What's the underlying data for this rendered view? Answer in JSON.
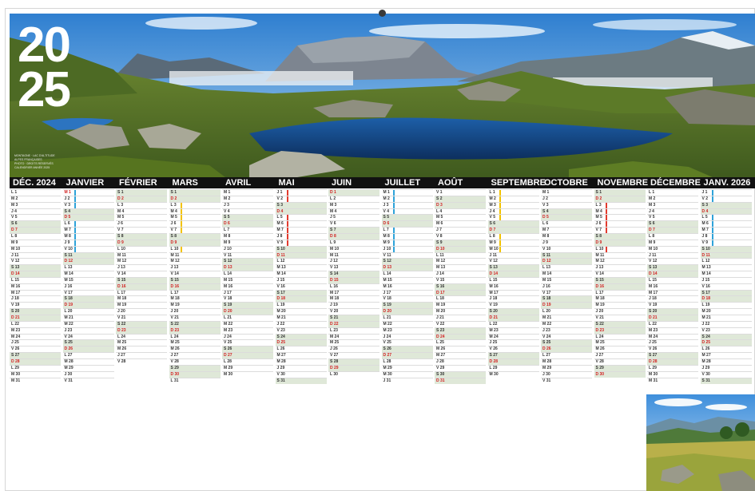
{
  "year_lines": [
    "20",
    "25"
  ],
  "credit_lines": [
    "MONTAGNE · LAC D'ALTITUDE",
    "ALPES FRANÇAISES",
    "PHOTO · DROITS RÉSERVÉS",
    "CALENDRIER ANNÉE 2025"
  ],
  "months": [
    {
      "label": "DÉC. 2024",
      "days": 31,
      "start": 0
    },
    {
      "label": "JANVIER",
      "days": 31,
      "start": 2
    },
    {
      "label": "FÉVRIER",
      "days": 28,
      "start": 5
    },
    {
      "label": "MARS",
      "days": 31,
      "start": 5
    },
    {
      "label": "AVRIL",
      "days": 30,
      "start": 1
    },
    {
      "label": "MAI",
      "days": 31,
      "start": 3
    },
    {
      "label": "JUIN",
      "days": 30,
      "start": 6
    },
    {
      "label": "JUILLET",
      "days": 31,
      "start": 1
    },
    {
      "label": "AOÛT",
      "days": 31,
      "start": 4
    },
    {
      "label": "SEPTEMBRE",
      "days": 30,
      "start": 0
    },
    {
      "label": "OCTOBRE",
      "days": 31,
      "start": 2
    },
    {
      "label": "NOVEMBRE",
      "days": 30,
      "start": 5
    },
    {
      "label": "DÉCEMBRE",
      "days": 31,
      "start": 0
    },
    {
      "label": "JANV. 2026",
      "days": 31,
      "start": 3
    }
  ],
  "weekday_letters": [
    "L",
    "M",
    "M",
    "J",
    "V",
    "S",
    "D"
  ],
  "colors": {
    "weekend": "#dfe8d8",
    "holiday": "#d21e1e",
    "bar": "#111111",
    "zoneA": "#f2c200",
    "zoneB": "#2fa3d9",
    "zoneC": "#e23b2e"
  }
}
